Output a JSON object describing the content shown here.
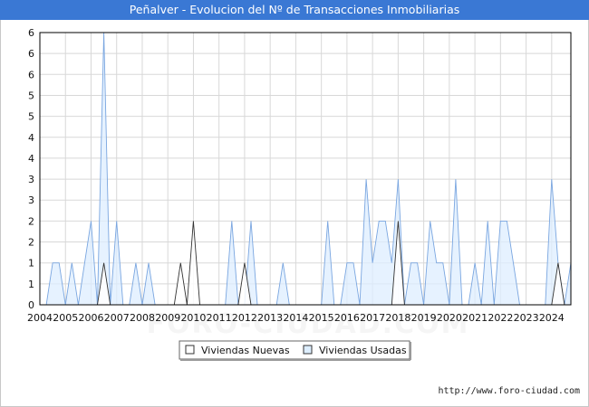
{
  "title": "Peñalver - Evolucion del Nº de Transacciones Inmobiliarias",
  "source": "http://www.foro-ciudad.com",
  "watermark": "FORO-CIUDAD.COM",
  "colors": {
    "title_bg": "#3a78d4",
    "nuevas_fill": "#ffffff",
    "nuevas_line": "#333333",
    "usadas_fill": "#ddeeff",
    "usadas_line": "#7aa6e0",
    "grid": "#d8d8d8"
  },
  "chart_data": {
    "type": "area",
    "title": "Peñalver - Evolucion del Nº de Transacciones Inmobiliarias",
    "xlabel": "",
    "ylabel": "",
    "ylim": [
      0,
      6.5
    ],
    "y_tick_values": [
      0,
      0.5,
      1,
      1.5,
      2,
      2.5,
      3,
      3.5,
      4,
      4.5,
      5,
      5.5,
      6,
      6.5
    ],
    "y_tick_labels": [
      "0",
      "1",
      "1",
      "2",
      "2",
      "3",
      "3",
      "4",
      "4",
      "5",
      "5",
      "6",
      "6",
      "6"
    ],
    "x_range": [
      2004,
      2024.75
    ],
    "x_tick_labels": [
      "2004",
      "2005",
      "2006",
      "2007",
      "2008",
      "2009",
      "2010",
      "2011",
      "2012",
      "2013",
      "2014",
      "2015",
      "2016",
      "2017",
      "2018",
      "2019",
      "2020",
      "2021",
      "2022",
      "2023",
      "2024"
    ],
    "grid": true,
    "legend_position": "bottom-center",
    "series": [
      {
        "name": "Viviendas Nuevas",
        "x": [
          2004.25,
          2004.5,
          2004.75,
          2005,
          2005.25,
          2005.5,
          2005.75,
          2006,
          2006.25,
          2006.5,
          2006.75,
          2007,
          2007.25,
          2007.5,
          2007.75,
          2008,
          2008.25,
          2008.5,
          2008.75,
          2009,
          2009.25,
          2009.5,
          2009.75,
          2010,
          2010.25,
          2010.5,
          2010.75,
          2011,
          2011.25,
          2011.5,
          2011.75,
          2012,
          2012.25,
          2012.5,
          2012.75,
          2013,
          2013.25,
          2013.5,
          2013.75,
          2014,
          2014.25,
          2014.5,
          2014.75,
          2015,
          2015.25,
          2015.5,
          2015.75,
          2016,
          2016.25,
          2016.5,
          2016.75,
          2017,
          2017.25,
          2017.5,
          2017.75,
          2018,
          2018.25,
          2018.5,
          2018.75,
          2019,
          2019.25,
          2019.5,
          2019.75,
          2020,
          2020.25,
          2020.5,
          2020.75,
          2021,
          2021.25,
          2021.5,
          2021.75,
          2022,
          2022.25,
          2022.5,
          2022.75,
          2023,
          2023.25,
          2023.5,
          2023.75,
          2024,
          2024.25,
          2024.5,
          2024.75
        ],
        "values": [
          0,
          0,
          0,
          0,
          0,
          0,
          0,
          0,
          0,
          1,
          0,
          0,
          0,
          0,
          0,
          0,
          0,
          0,
          0,
          0,
          0,
          1,
          0,
          2,
          0,
          0,
          0,
          0,
          0,
          0,
          0,
          1,
          0,
          0,
          0,
          0,
          0,
          0,
          0,
          0,
          0,
          0,
          0,
          0,
          0,
          0,
          0,
          0,
          0,
          0,
          0,
          0,
          0,
          0,
          0,
          2,
          0,
          0,
          0,
          0,
          0,
          0,
          0,
          0,
          0,
          0,
          0,
          0,
          0,
          0,
          0,
          0,
          0,
          0,
          0,
          0,
          0,
          0,
          0,
          0,
          1,
          0,
          0
        ]
      },
      {
        "name": "Viviendas Usadas",
        "x": [
          2004.25,
          2004.5,
          2004.75,
          2005,
          2005.25,
          2005.5,
          2005.75,
          2006,
          2006.25,
          2006.5,
          2006.75,
          2007,
          2007.25,
          2007.5,
          2007.75,
          2008,
          2008.25,
          2008.5,
          2008.75,
          2009,
          2009.25,
          2009.5,
          2009.75,
          2010,
          2010.25,
          2010.5,
          2010.75,
          2011,
          2011.25,
          2011.5,
          2011.75,
          2012,
          2012.25,
          2012.5,
          2012.75,
          2013,
          2013.25,
          2013.5,
          2013.75,
          2014,
          2014.25,
          2014.5,
          2014.75,
          2015,
          2015.25,
          2015.5,
          2015.75,
          2016,
          2016.25,
          2016.5,
          2016.75,
          2017,
          2017.25,
          2017.5,
          2017.75,
          2018,
          2018.25,
          2018.5,
          2018.75,
          2019,
          2019.25,
          2019.5,
          2019.75,
          2020,
          2020.25,
          2020.5,
          2020.75,
          2021,
          2021.25,
          2021.5,
          2021.75,
          2022,
          2022.25,
          2022.5,
          2022.75,
          2023,
          2023.25,
          2023.5,
          2023.75,
          2024,
          2024.25,
          2024.5,
          2024.75
        ],
        "values": [
          0,
          1,
          1,
          0,
          1,
          0,
          1,
          2,
          0,
          6.5,
          0,
          2,
          0,
          0,
          1,
          0,
          1,
          0,
          0,
          0,
          0,
          0,
          0,
          0,
          0,
          0,
          0,
          0,
          0,
          2,
          0,
          0,
          2,
          0,
          0,
          0,
          0,
          1,
          0,
          0,
          0,
          0,
          0,
          0,
          2,
          0,
          0,
          1,
          1,
          0,
          3,
          1,
          2,
          2,
          1,
          3,
          0,
          1,
          1,
          0,
          2,
          1,
          1,
          0,
          3,
          0,
          0,
          1,
          0,
          2,
          0,
          2,
          2,
          1,
          0,
          0,
          0,
          0,
          0,
          3,
          1,
          0,
          1
        ]
      }
    ]
  }
}
